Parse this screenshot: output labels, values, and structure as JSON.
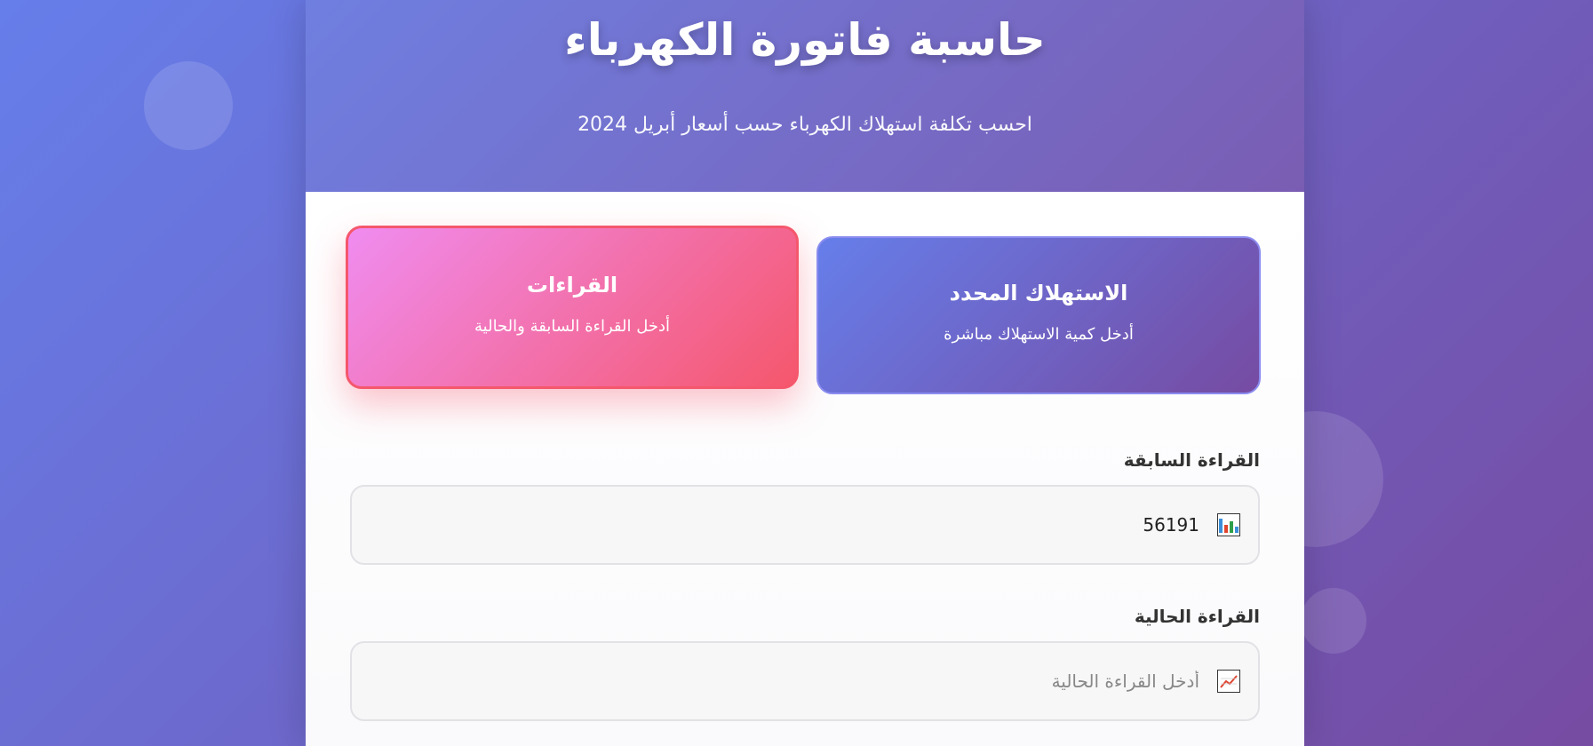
{
  "header": {
    "title": "حاسبة فاتورة الكهرباء",
    "subtitle": "احسب تكلفة استهلاك الكهرباء حسب أسعار أبريل 2024"
  },
  "modes": {
    "readings": {
      "title": "القراءات",
      "description": "أدخل القراءة السابقة والحالية",
      "active": true
    },
    "consumption": {
      "title": "الاستهلاك المحدد",
      "description": "أدخل كمية الاستهلاك مباشرة",
      "active": false
    }
  },
  "form": {
    "previous_reading": {
      "label": "القراءة السابقة",
      "value": "56191",
      "icon": "bar-chart-icon"
    },
    "current_reading": {
      "label": "القراءة الحالية",
      "placeholder": "أدخل القراءة الحالية",
      "value": "",
      "icon": "line-chart-icon"
    }
  },
  "colors": {
    "primary_gradient_start": "#667eea",
    "primary_gradient_end": "#764ba2",
    "active_card_start": "#f08cf0",
    "active_card_end": "#f5576c"
  }
}
